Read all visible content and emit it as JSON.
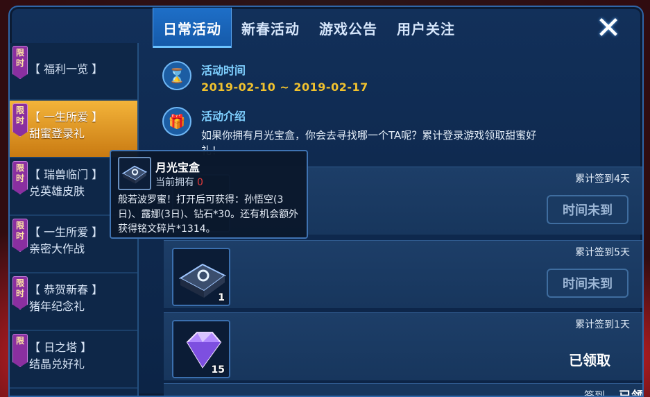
{
  "tabs": [
    {
      "label": "日常活动",
      "active": true
    },
    {
      "label": "新春活动",
      "active": false
    },
    {
      "label": "游戏公告",
      "active": false
    },
    {
      "label": "用户关注",
      "active": false
    }
  ],
  "close_icon": "close-icon",
  "sidebar": {
    "items": [
      {
        "badge": "限时",
        "line1": "【 福利一览 】",
        "line2": "",
        "active": false
      },
      {
        "badge": "限时",
        "line1": "【 一生所爱 】",
        "line2": "甜蜜登录礼",
        "active": true
      },
      {
        "badge": "限时",
        "line1": "【 瑞兽临门 】",
        "line2": "兑英雄皮肤",
        "active": false
      },
      {
        "badge": "限时",
        "line1": "【 一生所爱 】",
        "line2": "亲密大作战",
        "active": false
      },
      {
        "badge": "限时",
        "line1": "【 恭贺新春 】",
        "line2": "猪年纪念礼",
        "active": false
      },
      {
        "badge": "限",
        "line1": "【 日之塔 】",
        "line2": "结晶兑好礼",
        "active": false
      }
    ]
  },
  "activity": {
    "time_label": "活动时间",
    "time_value": "2019-02-10 ~ 2019-02-17",
    "intro_label": "活动介绍",
    "intro_text": "如果你拥有月光宝盒，你会去寻找哪一个TA呢？累计登录游戏领取甜蜜好礼！",
    "time_icon": "hourglass-icon",
    "intro_icon": "gift-icon"
  },
  "rewards": [
    {
      "condition": "累计签到4天",
      "count": "",
      "state": "时间未到",
      "claimed": false
    },
    {
      "condition": "累计签到5天",
      "count": "1",
      "state": "时间未到",
      "claimed": false
    },
    {
      "condition": "累计签到1天",
      "count": "15",
      "state": "已领取",
      "claimed": true
    }
  ],
  "partial_row": {
    "text": "签到",
    "state": "已领"
  },
  "tooltip": {
    "title": "月光宝盒",
    "owned_label": "当前拥有",
    "owned_count": "0",
    "description": "般若波罗蜜！打开后可获得：孙悟空(3日)、露娜(3日)、钻石*30。还有机会额外获得铭文碎片*1314。"
  },
  "colors": {
    "accent_blue": "#1e6fc8",
    "gold": "#f1c22e",
    "active_orange": "#f3b43a",
    "badge_purple": "#8a2fa0"
  }
}
